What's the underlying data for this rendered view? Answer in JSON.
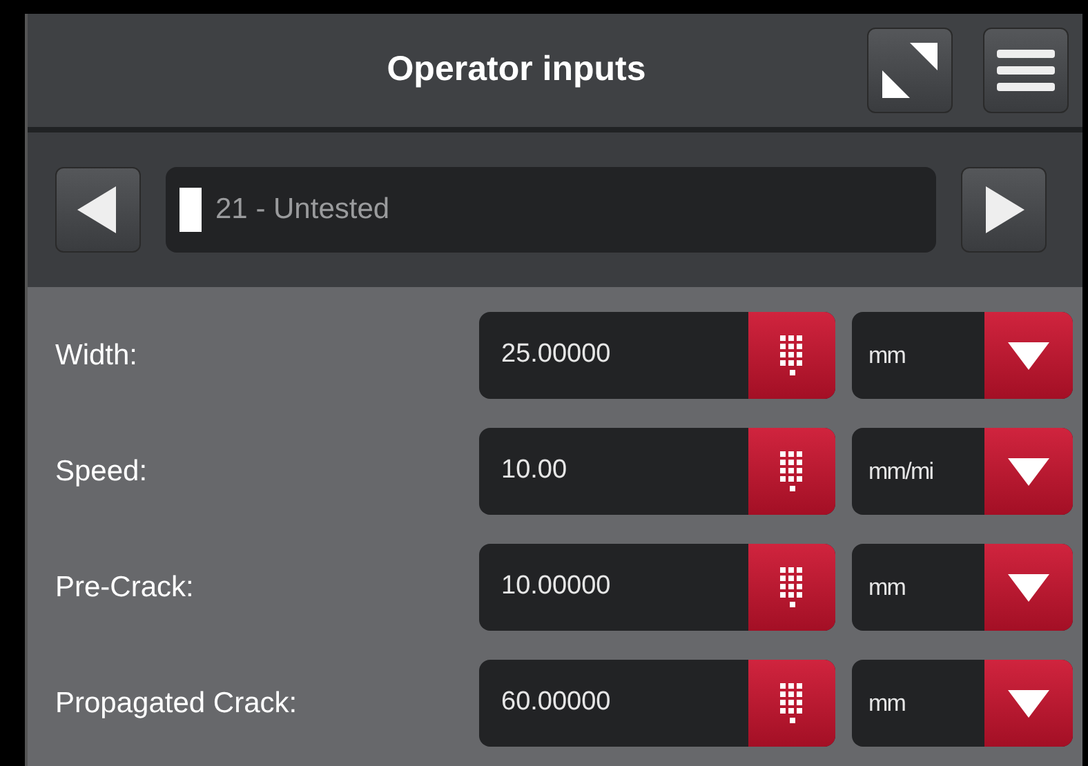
{
  "header": {
    "title": "Operator inputs"
  },
  "navigator": {
    "value": "21 - Untested"
  },
  "fields": [
    {
      "label": "Width:",
      "value": "25.00000",
      "unit": "mm"
    },
    {
      "label": "Speed:",
      "value": "10.00",
      "unit": "mm/mi"
    },
    {
      "label": "Pre-Crack:",
      "value": "10.00000",
      "unit": "mm"
    },
    {
      "label": "Propagated Crack:",
      "value": "60.00000",
      "unit": "mm"
    }
  ]
}
